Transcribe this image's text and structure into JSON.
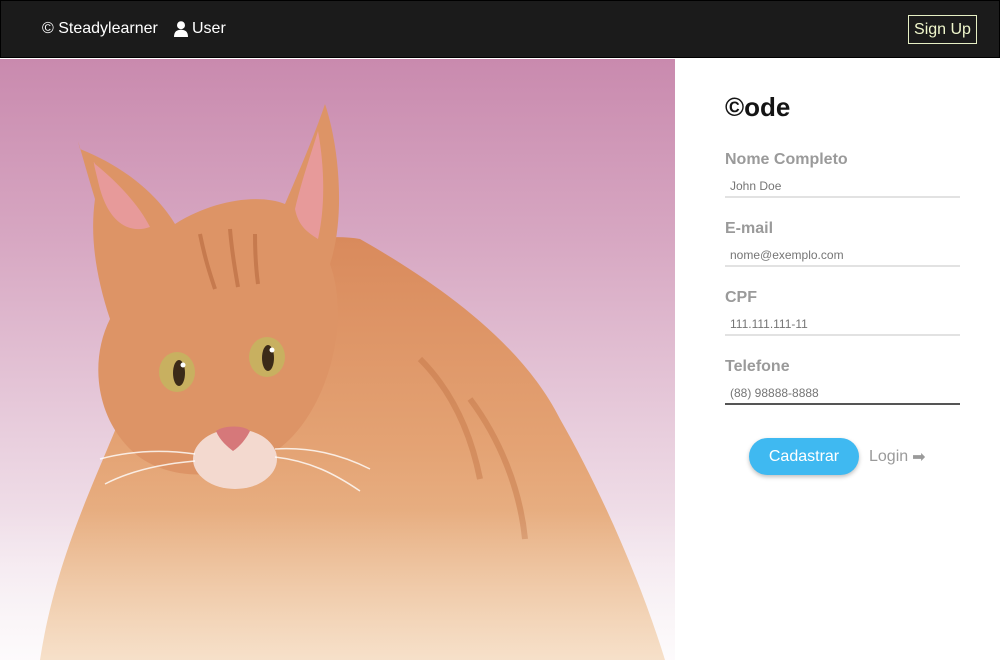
{
  "navbar": {
    "brand": "© Steadylearner",
    "user_label": "User",
    "signup_label": "Sign Up"
  },
  "form": {
    "title": "©ode",
    "fields": [
      {
        "label": "Nome Completo",
        "placeholder": "John Doe",
        "value": ""
      },
      {
        "label": "E-mail",
        "placeholder": "nome@exemplo.com",
        "value": ""
      },
      {
        "label": "CPF",
        "placeholder": "111.111.111-11",
        "value": ""
      },
      {
        "label": "Telefone",
        "placeholder": "(88) 98888-8888",
        "value": ""
      }
    ],
    "submit_label": "Cadastrar",
    "login_label": "Login",
    "login_arrow": "➡"
  },
  "icons": {
    "user": "user-icon",
    "login": "arrow-right-icon"
  },
  "colors": {
    "navbar_bg": "#1b1b1b",
    "signup_accent": "#f0f7cc",
    "submit_bg": "#3fb9f1",
    "label_gray": "#9a9a9a"
  }
}
